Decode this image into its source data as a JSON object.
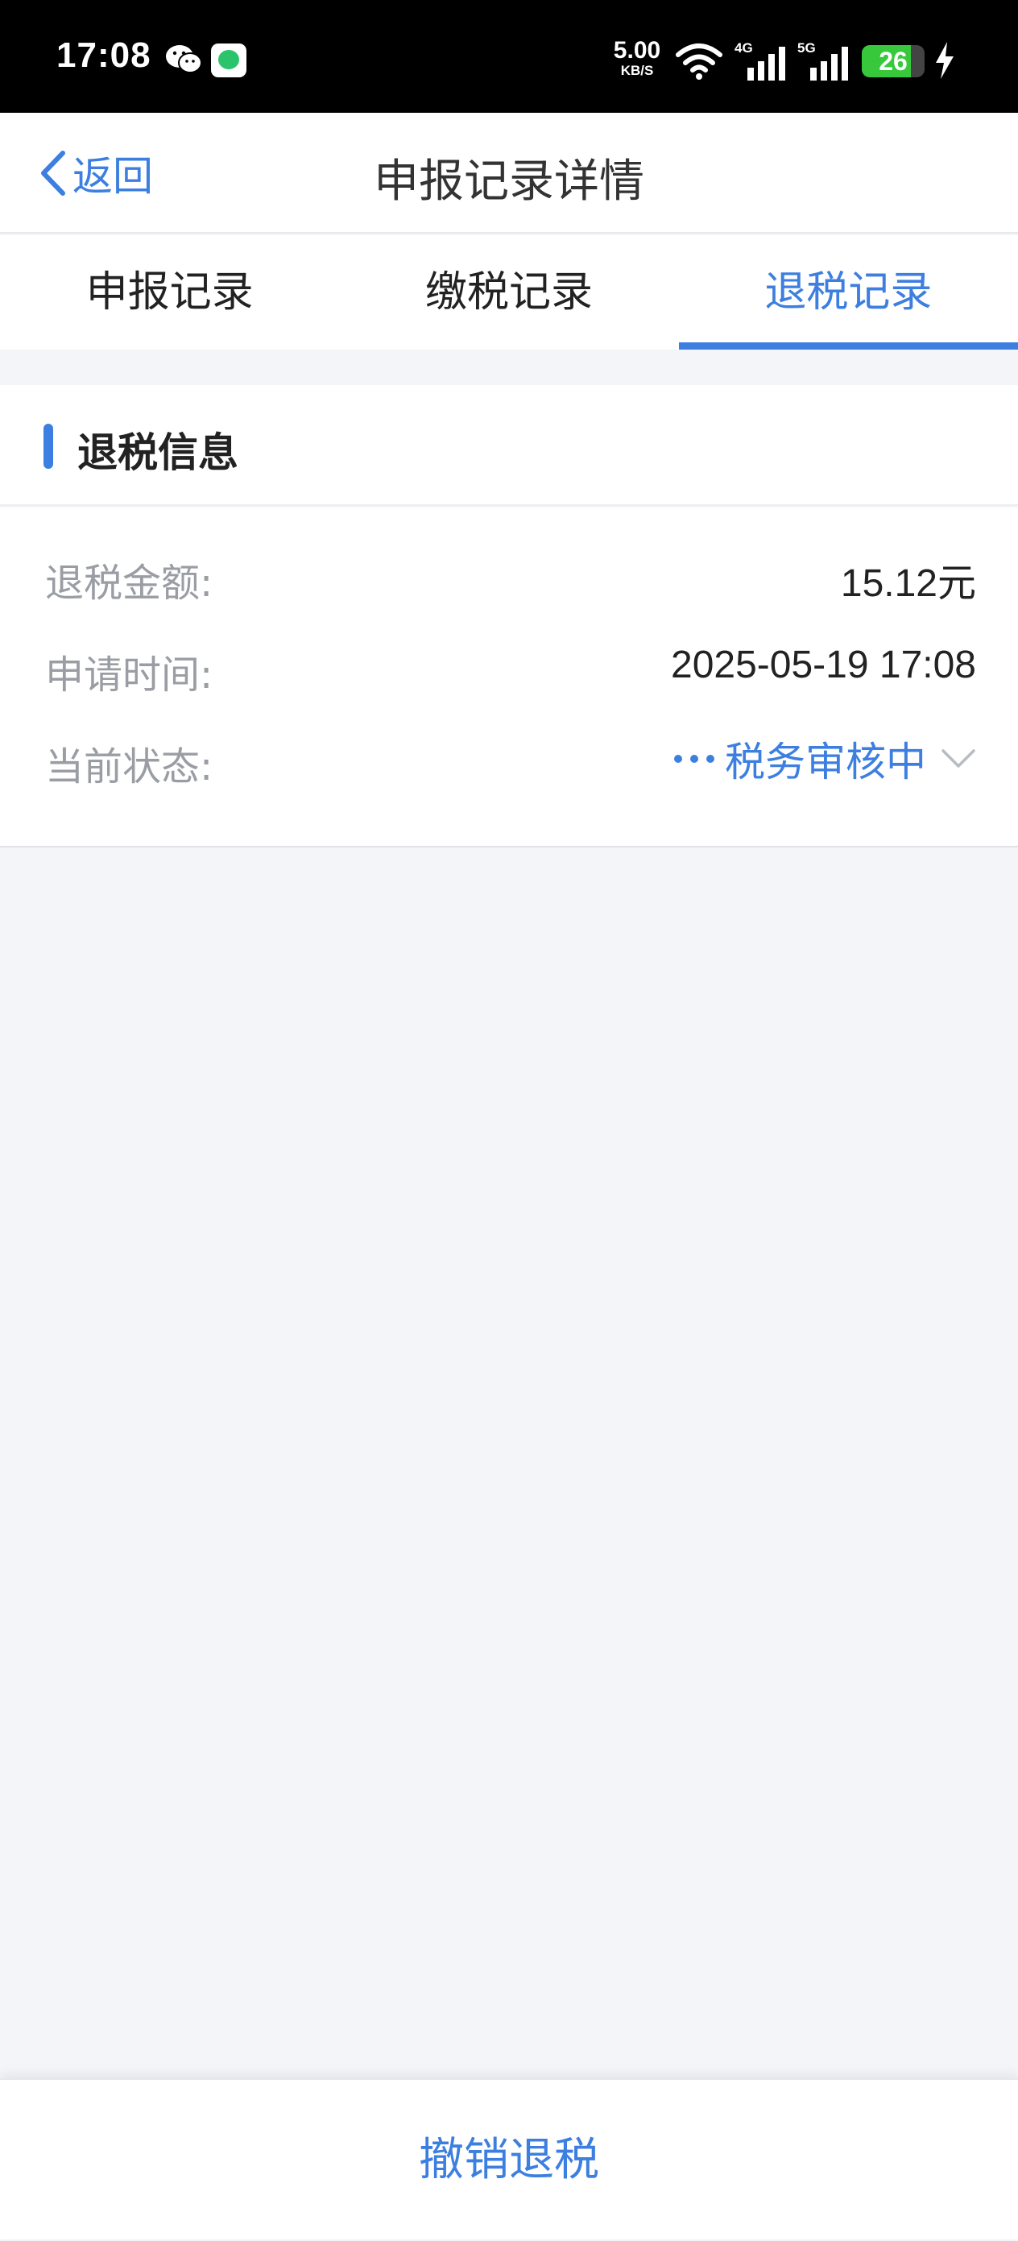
{
  "status_bar": {
    "time": "17:08",
    "net_speed": "5.00",
    "net_speed_unit": "KB/S",
    "network_4g": "4G",
    "network_5g": "5G",
    "battery_level": "26",
    "battery_fraction": 0.26,
    "battery_color": "#37c83c",
    "icons": [
      "wechat-icon",
      "message-app-icon",
      "wifi-icon",
      "signal-4g-icon",
      "signal-5g-icon",
      "battery-icon",
      "charging-bolt-icon"
    ]
  },
  "nav": {
    "back_label": "返回",
    "title": "申报记录详情"
  },
  "tabs": [
    {
      "label": "申报记录",
      "active": false
    },
    {
      "label": "缴税记录",
      "active": false
    },
    {
      "label": "退税记录",
      "active": true
    }
  ],
  "section": {
    "title": "退税信息"
  },
  "refund_info": {
    "amount_label": "退税金额:",
    "amount_value": "15.12元",
    "time_label": "申请时间:",
    "time_value": "2025-05-19 17:08",
    "status_label": "当前状态:",
    "status_value": "税务审核中"
  },
  "actions": {
    "cancel_refund": "撤销退税"
  },
  "colors": {
    "accent": "#3d7fe0",
    "background": "#f3f5f9",
    "label_gray": "#9a9da3"
  }
}
